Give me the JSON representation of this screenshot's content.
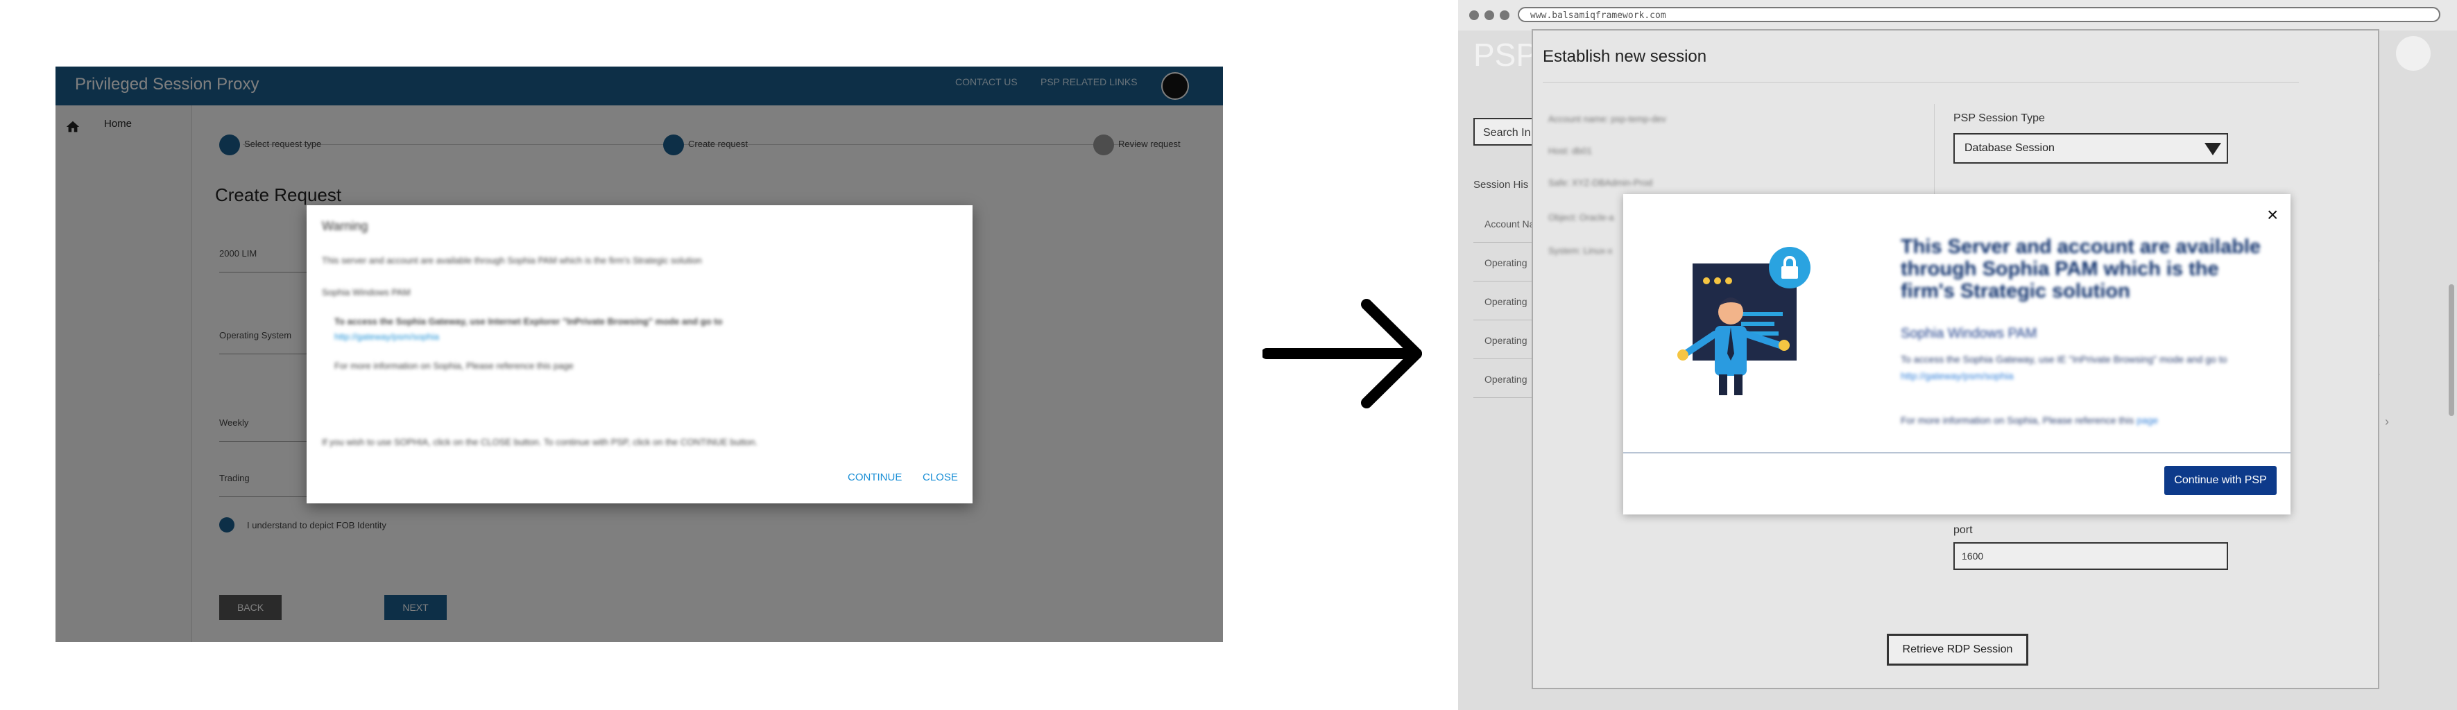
{
  "left": {
    "app_title": "Privileged Session Proxy",
    "nav_contact": "CONTACT US",
    "nav_links": "PSP RELATED LINKS",
    "sidebar_home": "Home",
    "steps": [
      "Select request type",
      "Create request",
      "Review request"
    ],
    "form_title": "Create Request",
    "field_values": [
      "2000 LIM",
      "Operating System",
      "Weekly",
      "Trading"
    ],
    "checkbox_label": "I understand to depict FOB Identity",
    "back_label": "BACK",
    "next_label": "NEXT",
    "dialog": {
      "title": "Warning",
      "line1": "This server and account are available through Sophia PAM which is the firm's Strategic solution",
      "line2": "Sophia Windows PAM",
      "line3": "To access the Sophia Gateway, use Internet Explorer \"InPrivate Browsing\" mode and go to",
      "line4": "http://gateway/psm/sophia",
      "line5": "For more information on Sophia, Please reference this page",
      "line6": "If you wish to use SOPHIA, click on the CLOSE button. To continue with PSP, click on the CONTINUE button.",
      "continue_label": "CONTINUE",
      "close_label": "CLOSE"
    }
  },
  "right": {
    "url": "www.balsamiqframework.com",
    "app_brand": "PSP",
    "search_label": "Search In",
    "history_label": "Session His",
    "history_items": [
      "Account Na",
      "Operating",
      "Operating",
      "Operating",
      "Operating"
    ],
    "panel_title": "Establish new session",
    "info_lines": [
      "Account name: psp-temp-dev",
      "Host: db01",
      "Safe: XYZ-DBAdmin-Prod",
      "Object: Oracle-a",
      "System: Linux-x"
    ],
    "session_type_label": "PSP Session Type",
    "session_type_value": "Database Session",
    "port_label": "port",
    "port_value": "1600",
    "retrieve_label": "Retrieve RDP Session",
    "modal": {
      "heading": "This Server and account are available through Sophia PAM which is the firm's Strategic solution",
      "subhead": "Sophia Windows PAM",
      "para1": "To access the Sophia Gateway, use IE \"InPrivate Browsing\" mode and go to",
      "para1_link": "http://gateway/psm/sophia",
      "para2": "For more information on Sophia, Please reference this",
      "para2_link": "page",
      "continue_label": "Continue with PSP",
      "close_symbol": "×"
    }
  },
  "colors": {
    "left_appbar": "#1a5f8f",
    "modal_heading": "#0d2f6b",
    "continue_button": "#0d3a8a"
  },
  "icons": [
    "home-icon",
    "avatar-icon",
    "arrow-right-icon",
    "close-icon",
    "lock-icon",
    "chevron-down-icon",
    "chevron-right-icon"
  ]
}
